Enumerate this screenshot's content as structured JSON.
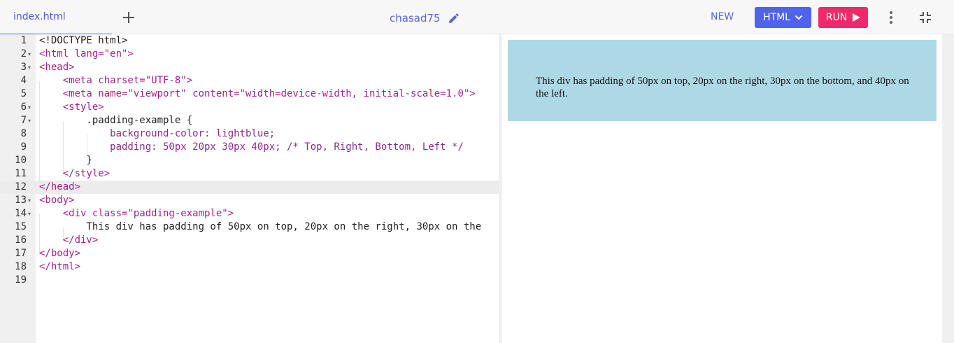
{
  "tabs": [
    {
      "label": "index.html"
    }
  ],
  "project": {
    "name": "chasad75"
  },
  "toolbar": {
    "new_label": "NEW",
    "html_label": "HTML",
    "run_label": "RUN"
  },
  "colors": {
    "accent": "#4f63f0",
    "run": "#ee2a6b",
    "preview_bg": "lightblue"
  },
  "editor": {
    "active_line": 12,
    "lines": [
      {
        "n": "1",
        "text": "<!DOCTYPE html>"
      },
      {
        "n": "2",
        "text": "<html lang=\"en\">"
      },
      {
        "n": "3",
        "text": "<head>"
      },
      {
        "n": "4",
        "text": "    <meta charset=\"UTF-8\">"
      },
      {
        "n": "5",
        "text": "    <meta name=\"viewport\" content=\"width=device-width, initial-scale=1.0\">"
      },
      {
        "n": "6",
        "text": "    <style>"
      },
      {
        "n": "7",
        "text": "        .padding-example {"
      },
      {
        "n": "8",
        "text": "            background-color: lightblue;"
      },
      {
        "n": "9",
        "text": "            padding: 50px 20px 30px 40px; /* Top, Right, Bottom, Left */"
      },
      {
        "n": "10",
        "text": "        }"
      },
      {
        "n": "11",
        "text": "    </style>"
      },
      {
        "n": "12",
        "text": "</head>"
      },
      {
        "n": "13",
        "text": "<body>"
      },
      {
        "n": "14",
        "text": "    <div class=\"padding-example\">"
      },
      {
        "n": "15",
        "text": "        This div has padding of 50px on top, 20px on the right, 30px on the"
      },
      {
        "n": "16",
        "text": "    </div>"
      },
      {
        "n": "17",
        "text": "</body>"
      },
      {
        "n": "18",
        "text": "</html>"
      },
      {
        "n": "19",
        "text": ""
      }
    ]
  },
  "preview": {
    "div_text": "This div has padding of 50px on top, 20px on the right, 30px on the bottom, and 40px on the left."
  }
}
